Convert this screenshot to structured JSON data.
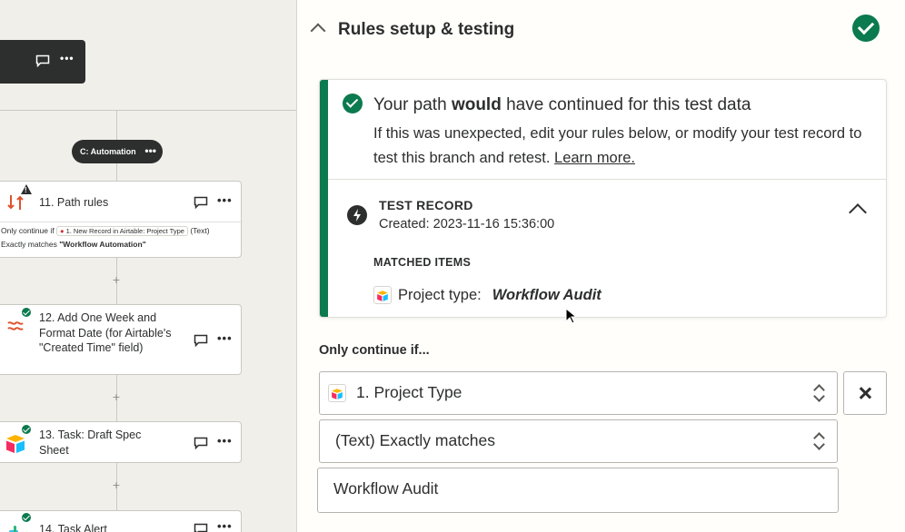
{
  "canvas": {
    "branch_label": "C: Automation",
    "steps": [
      {
        "title": "11. Path rules",
        "rule_prefix": "Only continue if",
        "rule_chip": "1. New Record in Airtable: Project Type",
        "rule_type": "(Text)",
        "rule_match_prefix": "Exactly matches",
        "rule_match_value": "\"Workflow Automation\""
      },
      {
        "title": "12. Add One Week and Format Date (for Airtable's \"Created Time\" field)"
      },
      {
        "title": "13. Task: Draft Spec Sheet"
      },
      {
        "title": "14. Task Alert"
      }
    ],
    "plus_symbol": "+",
    "more_symbol": "•••"
  },
  "panel": {
    "section_title": "Rules setup & testing",
    "result": {
      "headline_pre": "Your path ",
      "headline_bold": "would",
      "headline_post": " have continued for this test data",
      "subtext": "If this was unexpected, edit your rules below, or modify your test record to test this branch and retest. ",
      "learn_more": "Learn more."
    },
    "record": {
      "label": "TEST RECORD",
      "created": "Created: 2023-11-16 15:36:00",
      "matched_label": "MATCHED ITEMS",
      "matched_field": "Project type:",
      "matched_value": "Workflow Audit"
    },
    "rules": {
      "label": "Only continue if...",
      "field": "1. Project Type",
      "condition": "(Text) Exactly matches",
      "value": "Workflow Audit"
    }
  },
  "colors": {
    "success_green": "#0b7a4e",
    "dark": "#2d2e2e",
    "canvas_bg": "#f0efea",
    "panel_bg": "#fffefb"
  },
  "icons": [
    "chevron-up-icon",
    "success-check-icon",
    "bolt-icon",
    "airtable-logo-icon",
    "comment-icon",
    "more-icon",
    "close-icon",
    "sort-arrows-icon"
  ]
}
